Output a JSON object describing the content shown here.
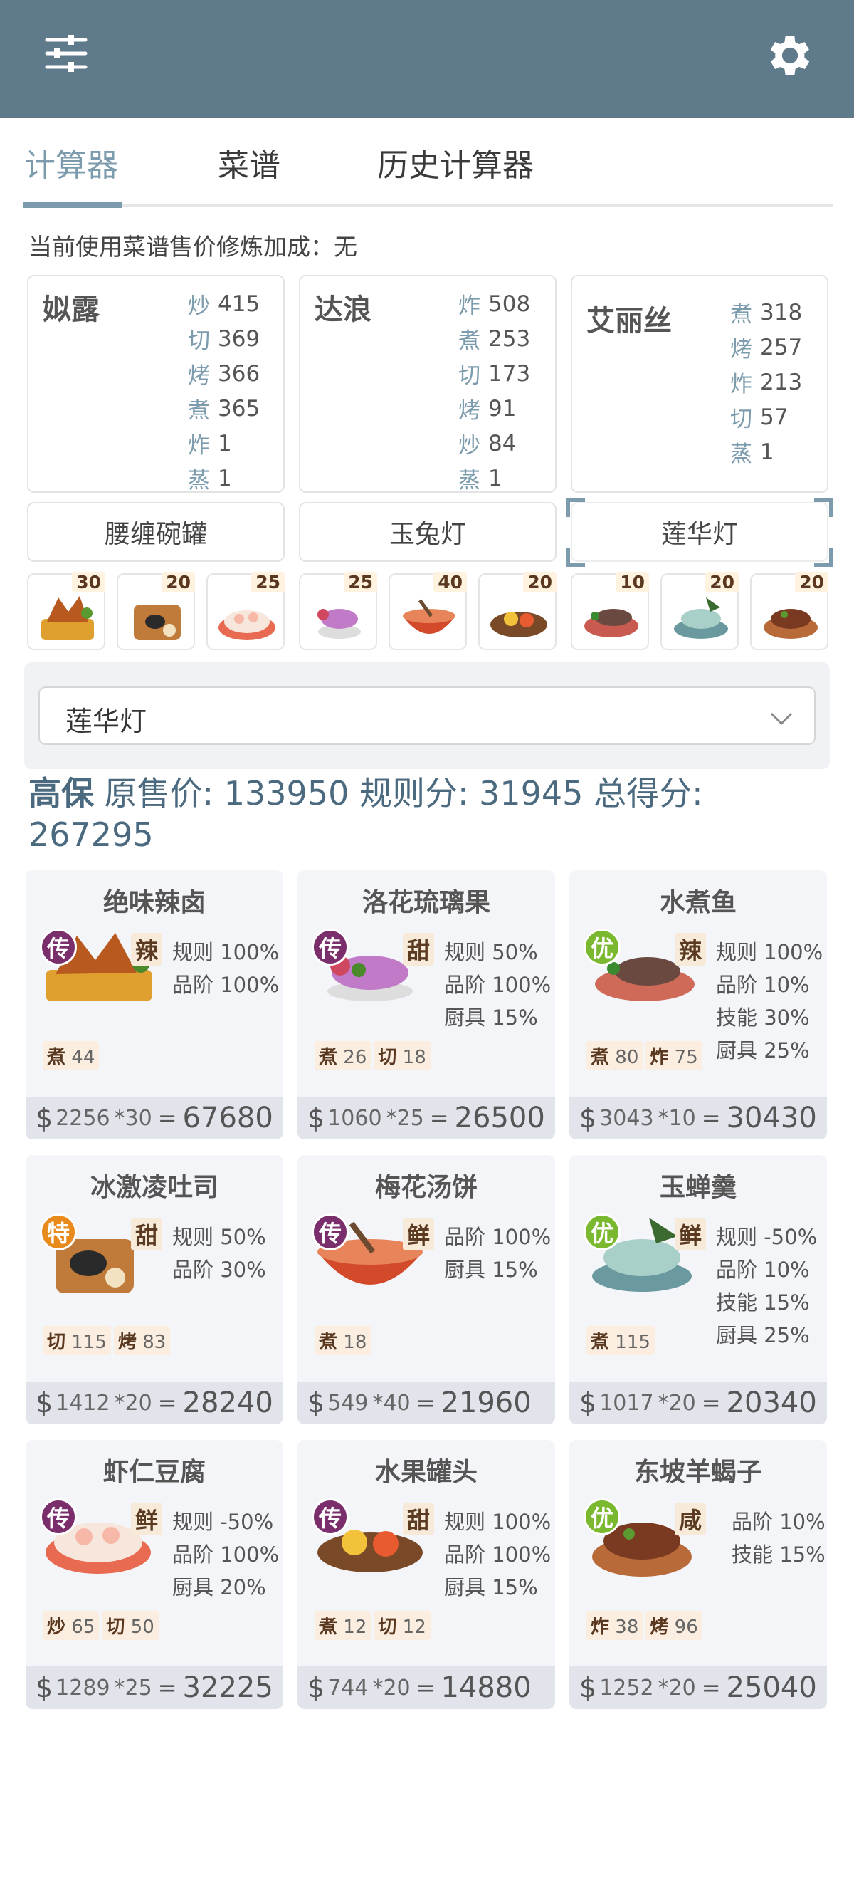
{
  "tabs": [
    "计算器",
    "菜谱",
    "历史计算器"
  ],
  "bonus_text": "当前使用菜谱售价修炼加成：无",
  "chefs": [
    {
      "name": "姒露",
      "skills": [
        [
          "炒",
          "415"
        ],
        [
          "切",
          "369"
        ],
        [
          "烤",
          "366"
        ],
        [
          "煮",
          "365"
        ],
        [
          "炸",
          "1"
        ],
        [
          "蒸",
          "1"
        ]
      ]
    },
    {
      "name": "达浪",
      "skills": [
        [
          "炸",
          "508"
        ],
        [
          "煮",
          "253"
        ],
        [
          "切",
          "173"
        ],
        [
          "烤",
          "91"
        ],
        [
          "炒",
          "84"
        ],
        [
          "蒸",
          "1"
        ]
      ]
    },
    {
      "name": "艾丽丝",
      "skills": [
        [
          "煮",
          "318"
        ],
        [
          "烤",
          "257"
        ],
        [
          "炸",
          "213"
        ],
        [
          "切",
          "57"
        ],
        [
          "蒸",
          "1"
        ]
      ]
    }
  ],
  "equipment": [
    "腰缠碗罐",
    "玉兔灯",
    "莲华灯"
  ],
  "dish_qty": [
    "30",
    "20",
    "25",
    "25",
    "40",
    "20",
    "10",
    "20",
    "20"
  ],
  "selected_equipment": "莲华灯",
  "summary": {
    "tag": "高保",
    "orig_label": "原售价:",
    "orig": "133950",
    "rule_label": "规则分:",
    "rule": "31945",
    "total_label": "总得分:",
    "total": "267295"
  },
  "recipes": [
    {
      "name": "绝味辣卤",
      "rank": "传",
      "flavor": "辣",
      "bonuses": [
        "规则 100%",
        "品阶 100%"
      ],
      "ingredients": [
        [
          "煮",
          "44"
        ]
      ],
      "price": "2256",
      "count": "*30",
      "total": "67680"
    },
    {
      "name": "洛花琉璃果",
      "rank": "传",
      "flavor": "甜",
      "bonuses": [
        "规则 50%",
        "品阶 100%",
        "厨具 15%"
      ],
      "ingredients": [
        [
          "煮",
          "26"
        ],
        [
          "切",
          "18"
        ]
      ],
      "price": "1060",
      "count": "*25",
      "total": "26500"
    },
    {
      "name": "水煮鱼",
      "rank": "优",
      "flavor": "辣",
      "bonuses": [
        "规则 100%",
        "品阶 10%",
        "技能 30%",
        "厨具 25%"
      ],
      "ingredients": [
        [
          "煮",
          "80"
        ],
        [
          "炸",
          "75"
        ]
      ],
      "price": "3043",
      "count": "*10",
      "total": "30430"
    },
    {
      "name": "冰激凌吐司",
      "rank": "特",
      "flavor": "甜",
      "bonuses": [
        "规则 50%",
        "品阶 30%"
      ],
      "ingredients": [
        [
          "切",
          "115"
        ],
        [
          "烤",
          "83"
        ]
      ],
      "price": "1412",
      "count": "*20",
      "total": "28240"
    },
    {
      "name": "梅花汤饼",
      "rank": "传",
      "flavor": "鲜",
      "bonuses": [
        "品阶 100%",
        "厨具 15%"
      ],
      "ingredients": [
        [
          "煮",
          "18"
        ]
      ],
      "price": "549",
      "count": "*40",
      "total": "21960"
    },
    {
      "name": "玉蝉羹",
      "rank": "优",
      "flavor": "鲜",
      "bonuses": [
        "规则 -50%",
        "品阶 10%",
        "技能 15%",
        "厨具 25%"
      ],
      "ingredients": [
        [
          "煮",
          "115"
        ]
      ],
      "price": "1017",
      "count": "*20",
      "total": "20340"
    },
    {
      "name": "虾仁豆腐",
      "rank": "传",
      "flavor": "鲜",
      "bonuses": [
        "规则 -50%",
        "品阶 100%",
        "厨具 20%"
      ],
      "ingredients": [
        [
          "炒",
          "65"
        ],
        [
          "切",
          "50"
        ]
      ],
      "price": "1289",
      "count": "*25",
      "total": "32225"
    },
    {
      "name": "水果罐头",
      "rank": "传",
      "flavor": "甜",
      "bonuses": [
        "规则 100%",
        "品阶 100%",
        "厨具 15%"
      ],
      "ingredients": [
        [
          "煮",
          "12"
        ],
        [
          "切",
          "12"
        ]
      ],
      "price": "744",
      "count": "*20",
      "total": "14880"
    },
    {
      "name": "东坡羊蝎子",
      "rank": "优",
      "flavor": "咸",
      "bonuses": [
        "品阶 10%",
        "技能 15%"
      ],
      "ingredients": [
        [
          "炸",
          "38"
        ],
        [
          "烤",
          "96"
        ]
      ],
      "price": "1252",
      "count": "*20",
      "total": "25040"
    }
  ],
  "colors": {
    "header": "#5e7a8b",
    "accent": "#7c9cad",
    "rank_chuan": "#7a2f6c",
    "rank_you": "#7ab830",
    "rank_te": "#e88a1c"
  }
}
